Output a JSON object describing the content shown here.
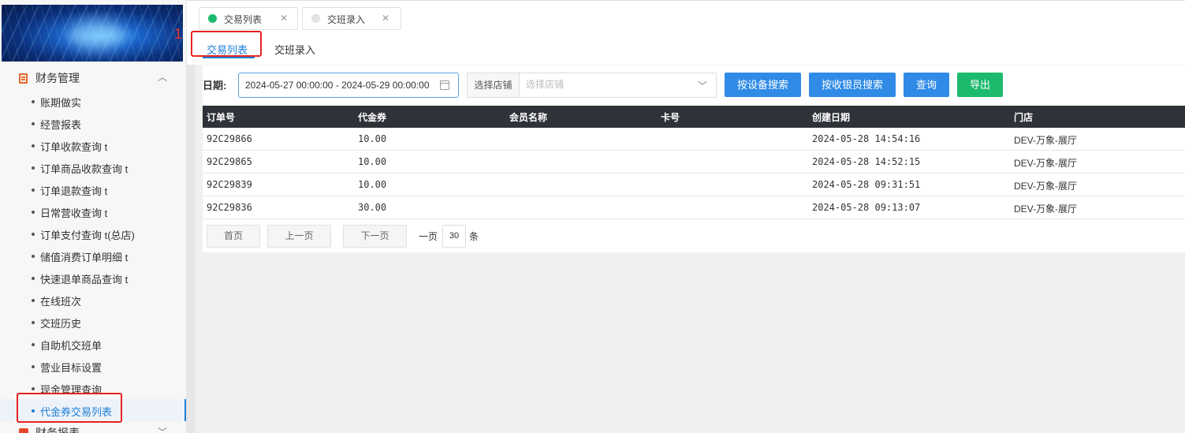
{
  "sidebar": {
    "banner_marker": "1",
    "group": {
      "label": "财务管理",
      "icon": "finance-doc-icon"
    },
    "items": [
      {
        "label": "账期做实"
      },
      {
        "label": "经营报表"
      },
      {
        "label": "订单收款查询 t"
      },
      {
        "label": "订单商品收款查询 t"
      },
      {
        "label": "订单退款查询 t"
      },
      {
        "label": "日常营收查询 t"
      },
      {
        "label": "订单支付查询 t(总店)"
      },
      {
        "label": "储值消费订单明细 t"
      },
      {
        "label": "快速退单商品查询 t"
      },
      {
        "label": "在线班次"
      },
      {
        "label": "交班历史"
      },
      {
        "label": "自助机交班单"
      },
      {
        "label": "营业目标设置"
      },
      {
        "label": "现金管理查询"
      },
      {
        "label": "代金券交易列表",
        "active": true
      }
    ],
    "group2": {
      "label": "财务报表",
      "icon": "report-icon"
    }
  },
  "chips": [
    {
      "label": "交易列表",
      "dot_color": "#1cba6c"
    },
    {
      "label": "交班录入",
      "dot_color": "#e2e2e2"
    }
  ],
  "subtabs": [
    {
      "label": "交易列表",
      "active": true
    },
    {
      "label": "交班录入"
    }
  ],
  "filter": {
    "date_label": "日期:",
    "date_value": "2024-05-27 00:00:00 - 2024-05-29 00:00:00",
    "store_label": "选择店铺",
    "store_placeholder": "选择店铺",
    "buttons": {
      "by_device": "按设备搜索",
      "by_cashier": "按收银员搜索",
      "query": "查询",
      "export": "导出"
    }
  },
  "table": {
    "columns": [
      "订单号",
      "代金券",
      "会员名称",
      "卡号",
      "创建日期",
      "门店"
    ],
    "rows": [
      [
        "92C29866",
        "10.00",
        "",
        "",
        "2024-05-28 14:54:16",
        "DEV-万象-展厅"
      ],
      [
        "92C29865",
        "10.00",
        "",
        "",
        "2024-05-28 14:52:15",
        "DEV-万象-展厅"
      ],
      [
        "92C29839",
        "10.00",
        "",
        "",
        "2024-05-28 09:31:51",
        "DEV-万象-展厅"
      ],
      [
        "92C29836",
        "30.00",
        "",
        "",
        "2024-05-28 09:13:07",
        "DEV-万象-展厅"
      ]
    ]
  },
  "pager": {
    "first": "首页",
    "prev": "上一页",
    "next": "下一页",
    "per_page_prefix": "一页",
    "per_page_value": "30",
    "per_page_suffix": "条"
  },
  "colors": {
    "accent": "#1e7fd8",
    "button_blue": "#2f8be6",
    "button_green": "#1cba6c",
    "table_header": "#2f3238",
    "highlight_red": "#e8231f"
  }
}
